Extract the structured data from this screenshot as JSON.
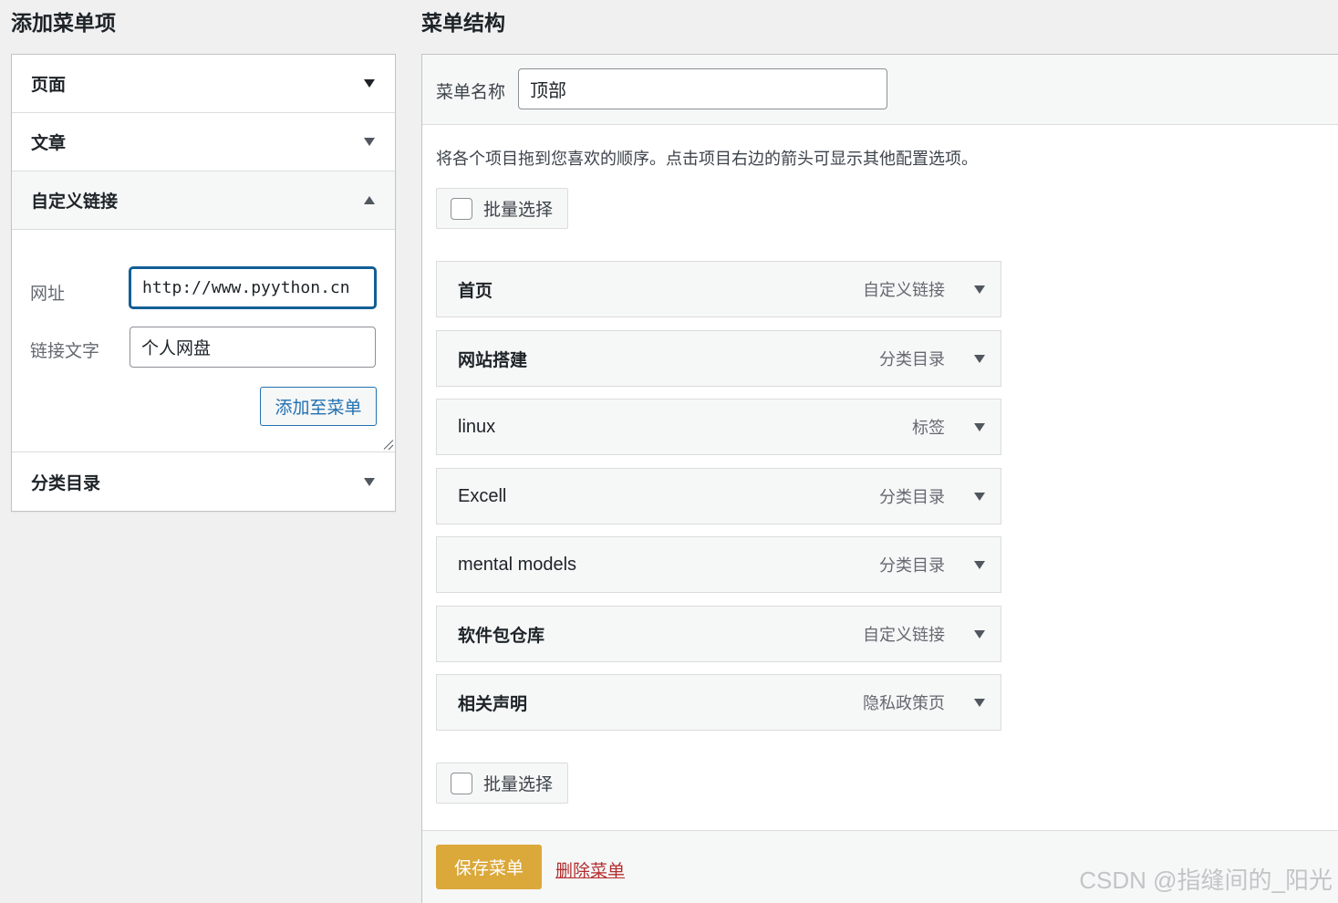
{
  "left": {
    "title": "添加菜单项",
    "sections": [
      {
        "label": "页面",
        "state": "collapsed"
      },
      {
        "label": "文章",
        "state": "collapsed"
      },
      {
        "label": "自定义链接",
        "state": "expanded"
      },
      {
        "label": "分类目录",
        "state": "collapsed"
      }
    ],
    "custom_link": {
      "url_label": "网址",
      "url_value": "http://www.pyython.cn",
      "text_label": "链接文字",
      "text_value": "个人网盘",
      "add_button": "添加至菜单"
    }
  },
  "right": {
    "title": "菜单结构",
    "menu_name_label": "菜单名称",
    "menu_name_value": "顶部",
    "instructions": "将各个项目拖到您喜欢的顺序。点击项目右边的箭头可显示其他配置选项。",
    "bulk_select": "批量选择",
    "items": [
      {
        "title": "首页",
        "type": "自定义链接"
      },
      {
        "title": "网站搭建",
        "type": "分类目录"
      },
      {
        "title": "linux",
        "type": "标签"
      },
      {
        "title": "Excell",
        "type": "分类目录"
      },
      {
        "title": "mental models",
        "type": "分类目录"
      },
      {
        "title": "软件包仓库",
        "type": "自定义链接"
      },
      {
        "title": "相关声明",
        "type": "隐私政策页"
      }
    ],
    "save_button": "保存菜单",
    "delete_link": "删除菜单"
  },
  "watermark": "CSDN @指缝间的_阳光",
  "colors": {
    "primary": "#dba83a",
    "link": "#2271b1",
    "danger": "#b32d2e"
  }
}
